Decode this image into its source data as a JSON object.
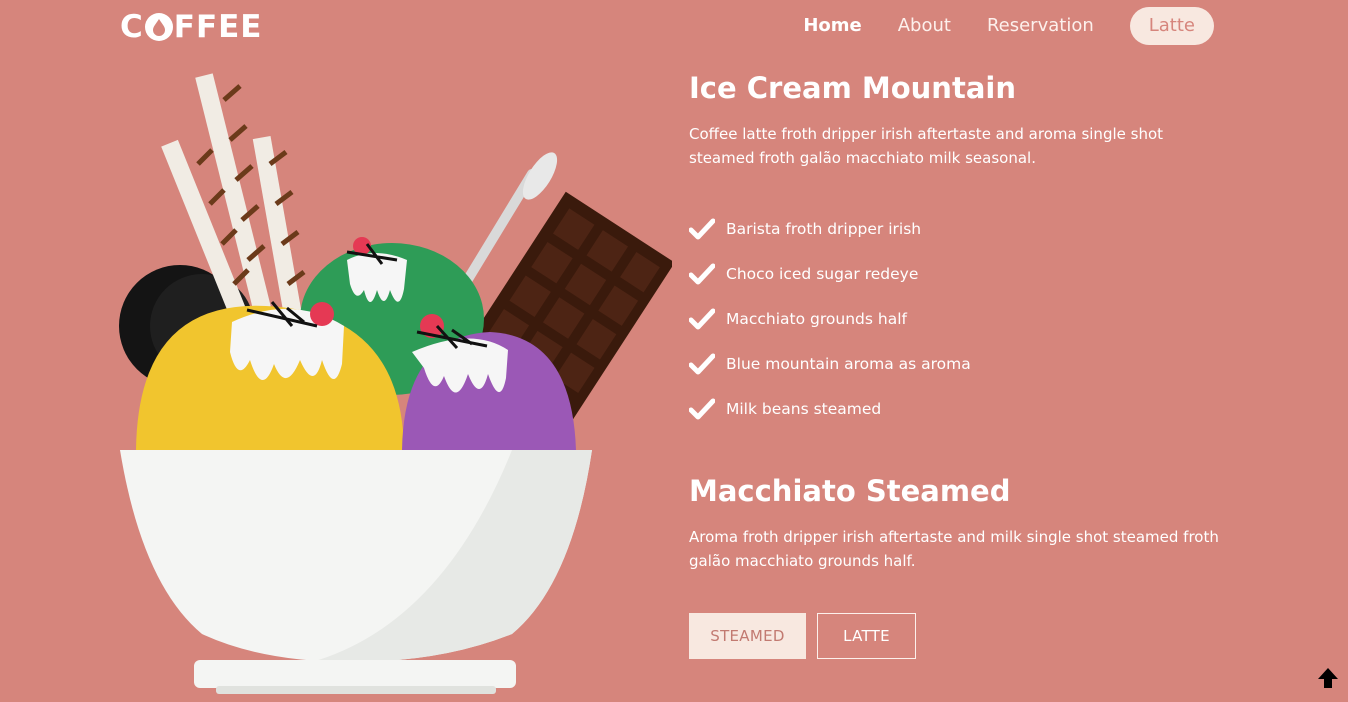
{
  "brand": {
    "logo_text_pre": "C",
    "logo_text_post": "FFEE"
  },
  "nav": {
    "items": [
      {
        "label": "Home"
      },
      {
        "label": "About"
      },
      {
        "label": "Reservation"
      },
      {
        "label": "Latte"
      }
    ]
  },
  "section1": {
    "title": "Ice Cream Mountain",
    "description": "Coffee latte froth dripper irish aftertaste and aroma single shot steamed froth galão macchiato milk seasonal.",
    "features": [
      "Barista froth dripper irish",
      "Choco iced sugar redeye",
      "Macchiato grounds half",
      "Blue mountain aroma as aroma",
      "Milk beans steamed"
    ]
  },
  "section2": {
    "title": "Macchiato Steamed",
    "description": "Aroma froth dripper irish aftertaste and milk single shot steamed froth galão macchiato grounds half.",
    "buttons": [
      {
        "label": "STEAMED"
      },
      {
        "label": "LATTE"
      }
    ]
  },
  "icons": {
    "check": "check-icon",
    "scroll_top": "arrow-up-icon",
    "logo_cup": "coffee-drop-icon"
  },
  "colors": {
    "background": "#d6857c",
    "pill_bg": "#f8e8e0",
    "text": "#ffffff"
  }
}
